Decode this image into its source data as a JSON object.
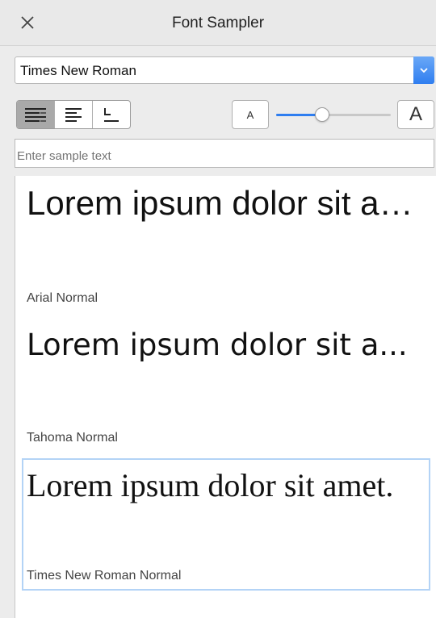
{
  "window": {
    "title": "Font Sampler"
  },
  "font_select": {
    "value": "Times New Roman"
  },
  "alignment": {
    "options": [
      "justify",
      "left",
      "spacing"
    ],
    "selected": "justify"
  },
  "size_slider": {
    "small_label": "A",
    "large_label": "A",
    "value_fraction": 0.4
  },
  "sample_input": {
    "placeholder": "Enter sample text",
    "value": ""
  },
  "previews": [
    {
      "sample": "Lorem ipsum dolor sit a…",
      "font_name": "Arial Normal",
      "selected": false
    },
    {
      "sample": "Lorem ipsum dolor sit a...",
      "font_name": "Tahoma Normal",
      "selected": false
    },
    {
      "sample": "Lorem ipsum dolor sit amet.",
      "font_name": "Times New Roman Normal",
      "selected": true
    }
  ],
  "colors": {
    "accent": "#2f7ef0",
    "selection_border": "#b3d3f6",
    "background": "#ececec"
  }
}
